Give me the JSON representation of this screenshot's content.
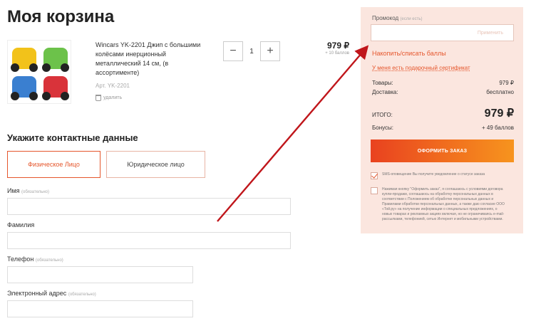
{
  "page_title": "Моя корзина",
  "product": {
    "name": "Wincars YK-2201 Джип с большими колёсами инерционный металлический 14 см, (в ассортименте)",
    "sku": "Арт. YK-2201",
    "delete_label": "удалить",
    "quantity": "1",
    "minus": "−",
    "plus": "+",
    "price": "979 ₽",
    "bonus": "+ 10 баллов"
  },
  "contact": {
    "title": "Укажите контактные данные",
    "type_physical": "Физическое Лицо",
    "type_juridical": "Юридическое лицо",
    "fields": [
      {
        "label": "Имя",
        "hint": "(обязательно)"
      },
      {
        "label": "Фамилия",
        "hint": ""
      },
      {
        "label": "Телефон",
        "hint": "(обязательно)"
      },
      {
        "label": "Электронный адрес",
        "hint": "(обязательно)"
      }
    ]
  },
  "order": {
    "promo_label": "Промокод",
    "promo_hint": "(если есть)",
    "promo_apply": "Применить",
    "bonus_link": "Накопить/списать баллы",
    "certificate_link": "У меня есть подарочный сертификат",
    "goods_label": "Товары:",
    "goods_value": "979 ₽",
    "delivery_label": "Доставка:",
    "delivery_value": "бесплатно",
    "total_label": "ИТОГО:",
    "total_value": "979 ₽",
    "bonuses_label": "Бонусы:",
    "bonuses_value": "+ 49 баллов",
    "submit": "ОФОРМИТЬ ЗАКАЗ",
    "sms_text": "SMS-оповещение Вы получите уведомление о статусе заказа",
    "agree_text": "Нажимая кнопку \"Оформить заказ\", я соглашаюсь с условиями договора купли-продажи, соглашаюсь на обработку персональных данных в соответствии с Положением об обработке персональных данных и Правилами обработки персональных данных, а также даю согласие ООО «Той.ру» на получение информации о специальных предложениях, о новых товарах и рекламных акциях включая, но не ограничиваясь e-mail-рассылками, телефонией, сетью Интернет и мобильными устройствами.",
    "sms_checked": true,
    "agree_checked": false
  },
  "colors": {
    "accent": "#e5562c",
    "panel_bg": "#fbe6df",
    "arrow": "#c0161b"
  }
}
